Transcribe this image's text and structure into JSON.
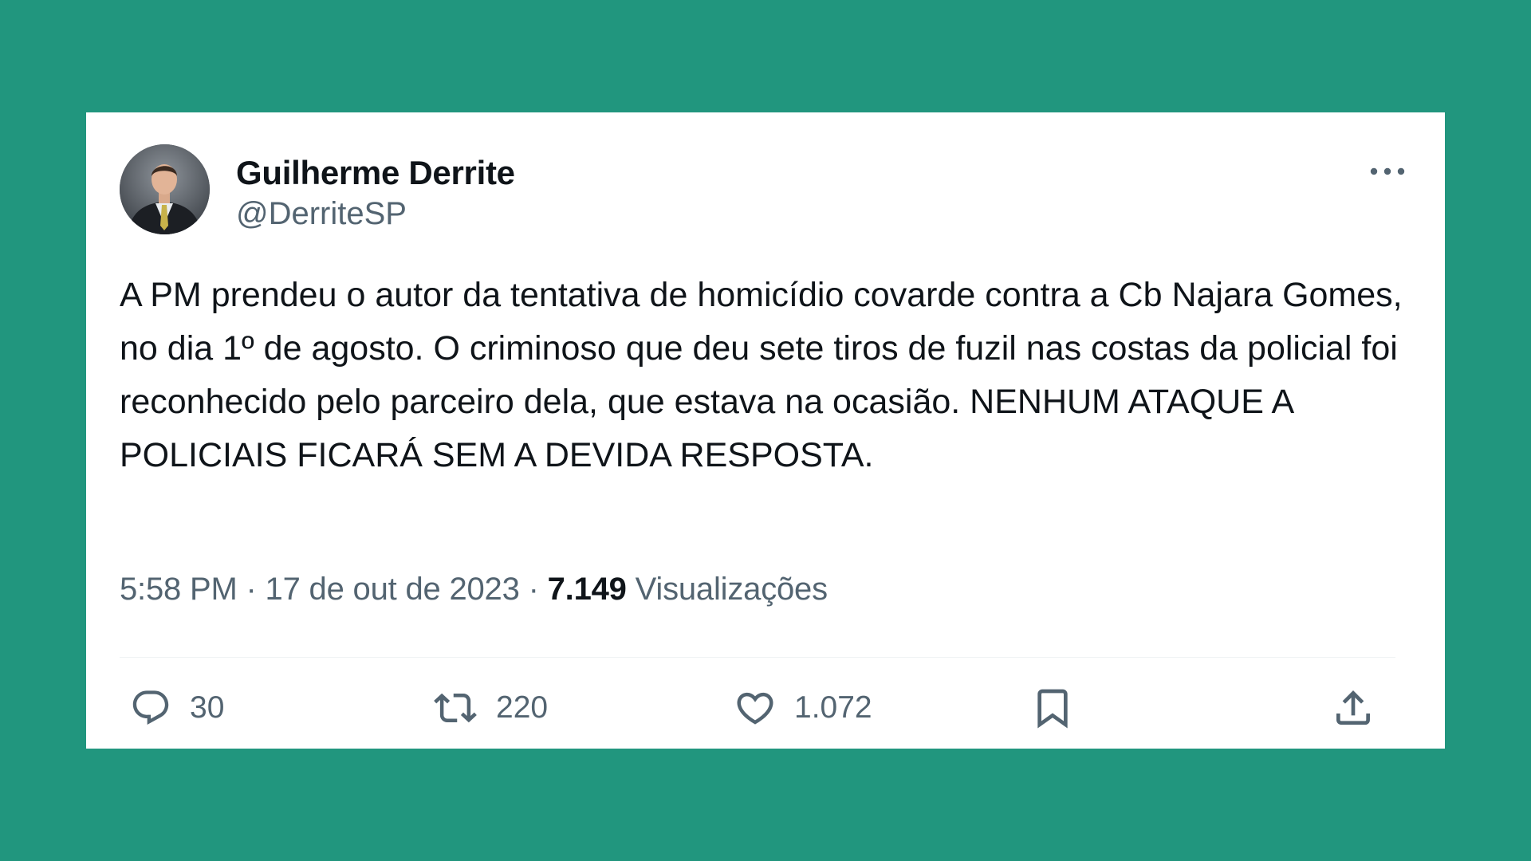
{
  "tweet": {
    "author": {
      "display_name": "Guilherme Derrite",
      "handle": "@DerriteSP"
    },
    "text": "A PM prendeu o autor da tentativa de homicídio covarde contra a Cb Najara Gomes, no dia 1º de agosto. O criminoso que deu sete tiros de fuzil nas costas da policial foi reconhecido pelo parceiro dela, que estava na ocasião. NENHUM ATAQUE A POLICIAIS FICARÁ SEM A DEVIDA RESPOSTA.",
    "time": "5:58 PM",
    "date": "17 de out de 2023",
    "separator": " · ",
    "views_count": "7.149",
    "views_label": "Visualizações",
    "actions": {
      "replies": "30",
      "retweets": "220",
      "likes": "1.072"
    }
  },
  "icons": {
    "more": "more-horizontal-icon",
    "reply": "reply-icon",
    "retweet": "retweet-icon",
    "like": "heart-icon",
    "bookmark": "bookmark-icon",
    "share": "share-icon"
  },
  "colors": {
    "background": "#21967e",
    "card": "#ffffff",
    "text_primary": "#0f1419",
    "text_secondary": "#536471",
    "divider": "#eff3f4"
  }
}
